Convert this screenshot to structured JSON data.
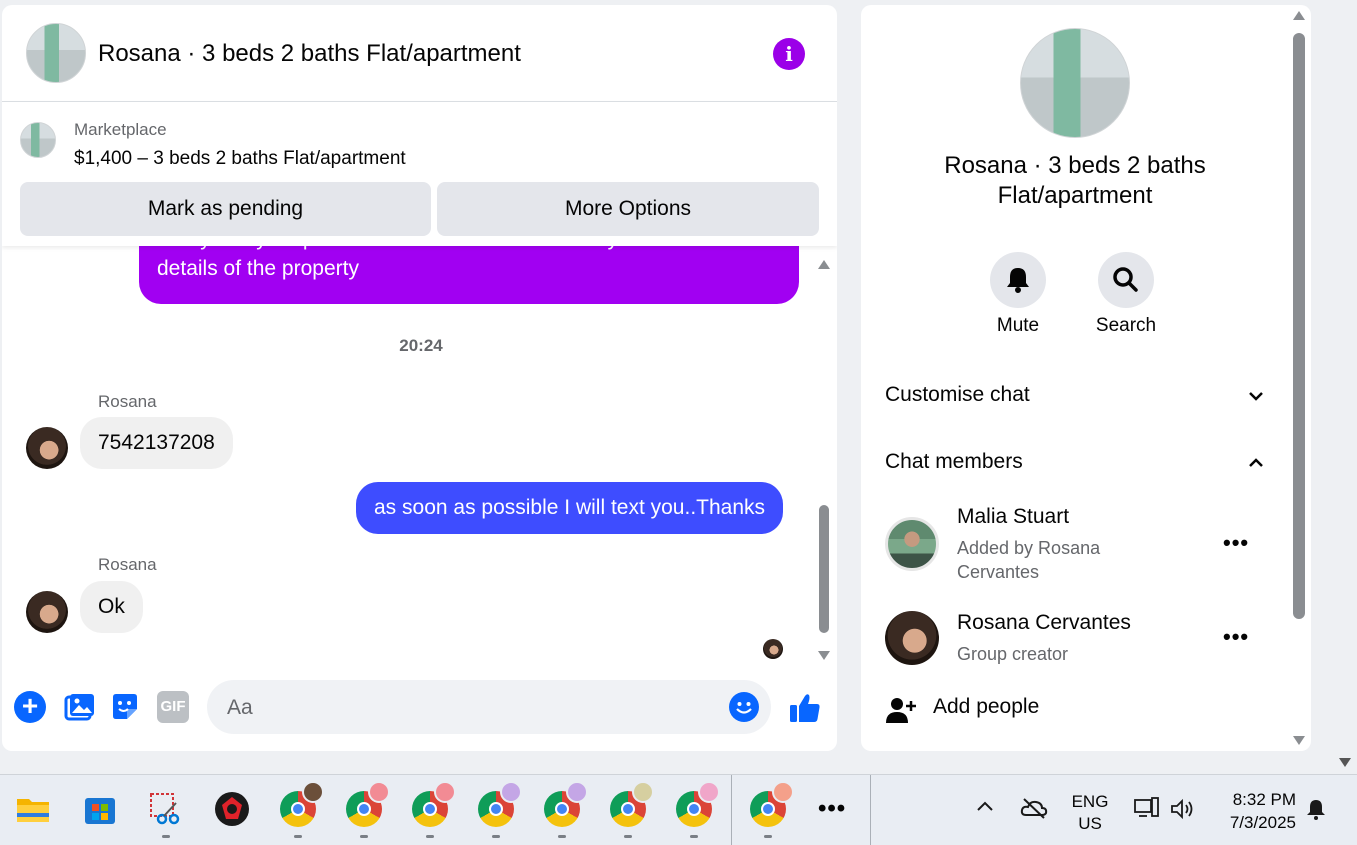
{
  "header": {
    "title": "Rosana · 3 beds 2 baths Flat/apartment"
  },
  "marketplace": {
    "label": "Marketplace",
    "item": "$1,400 – 3 beds 2 baths Flat/apartment",
    "pending_label": "Mark as pending",
    "more_label": "More Options"
  },
  "messages": {
    "partial_outgoing": "kindly text your phone number I will reach out to you with more details of the property",
    "timestamp": "20:24",
    "sender1": "Rosana",
    "phone": "7542137208",
    "outgoing": "as soon as possible I will text you..Thanks",
    "sender2": "Rosana",
    "ok": "Ok"
  },
  "composer": {
    "placeholder": "Aa",
    "gif_label": "GIF"
  },
  "info": {
    "title": "Rosana · 3 beds 2 baths Flat/apartment",
    "mute_label": "Mute",
    "search_label": "Search",
    "customise_label": "Customise chat",
    "members_label": "Chat members",
    "members": [
      {
        "name": "Malia Stuart",
        "sub": "Added by Rosana Cervantes"
      },
      {
        "name": "Rosana Cervantes",
        "sub": "Group creator"
      }
    ],
    "add_people_label": "Add people"
  },
  "taskbar": {
    "lang_top": "ENG",
    "lang_bottom": "US",
    "time": "8:32 PM",
    "date": "7/3/2025",
    "more_label": "•••"
  },
  "colors": {
    "accent_purple": "#a100f2",
    "accent_blue_bubble": "#3e4dff",
    "messenger_blue": "#0866ff"
  }
}
